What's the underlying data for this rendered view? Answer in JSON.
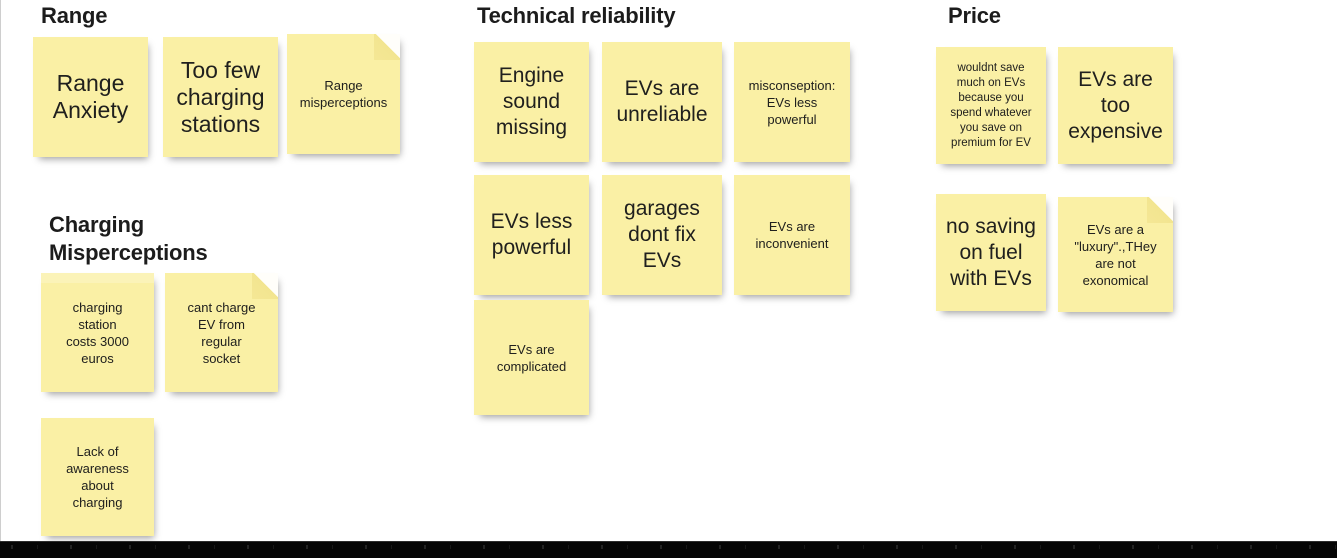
{
  "board": {
    "background": "#ffffff",
    "note_color": "#faf0a5",
    "text_color": "#20201e",
    "title_color": "#1c1c1c"
  },
  "sections": [
    {
      "id": "range",
      "title": "Range",
      "notes": [
        {
          "text": "Range\nAnxiety"
        },
        {
          "text": "Too few\ncharging\nstations"
        },
        {
          "text": "Range\nmisperceptions"
        }
      ]
    },
    {
      "id": "charging-misperceptions",
      "title": "Charging\nMisperceptions",
      "notes": [
        {
          "text": "charging\nstation\ncosts 3000\neuros"
        },
        {
          "text": "cant charge\nEV from\nregular\nsocket"
        },
        {
          "text": "Lack of\nawareness\nabout\ncharging"
        }
      ]
    },
    {
      "id": "technical-reliability",
      "title": "Technical reliability",
      "notes": [
        {
          "text": "Engine\nsound\nmissing"
        },
        {
          "text": "EVs are\nunreliable"
        },
        {
          "text": "misconseption:\nEVs less\npowerful"
        },
        {
          "text": "EVs less\npowerful"
        },
        {
          "text": "garages\ndont fix\nEVs"
        },
        {
          "text": "EVs are\ninconvenient"
        },
        {
          "text": "EVs are\ncomplicated"
        }
      ]
    },
    {
      "id": "price",
      "title": "Price",
      "notes": [
        {
          "text": "wouldnt save\nmuch on EVs\nbecause you\nspend whatever\nyou save on\npremium for EV"
        },
        {
          "text": "EVs are\ntoo\nexpensive"
        },
        {
          "text": "no saving\non fuel\nwith EVs"
        },
        {
          "text": "EVs are a\n\"luxury\".,THey\nare not\nexonomical"
        }
      ]
    }
  ]
}
